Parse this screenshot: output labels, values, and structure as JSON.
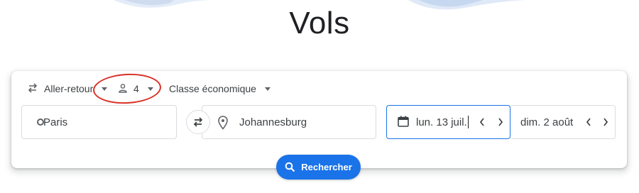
{
  "title": "Vols",
  "options": {
    "trip_type": "Aller-retour",
    "passengers": "4",
    "cabin_class": "Classe économique"
  },
  "fields": {
    "origin": "Paris",
    "destination": "Johannesburg",
    "departure_date": "lun. 13 juil.",
    "return_date": "dim. 2 août"
  },
  "search_button": "Rechercher",
  "icons": {
    "trip": "swap-horizontal-icon",
    "passengers": "person-icon",
    "origin": "circle-icon",
    "destination": "location-pin-icon",
    "calendar": "calendar-icon",
    "search": "search-icon"
  },
  "colors": {
    "accent": "#1a73e8",
    "annotation": "#d93025"
  }
}
